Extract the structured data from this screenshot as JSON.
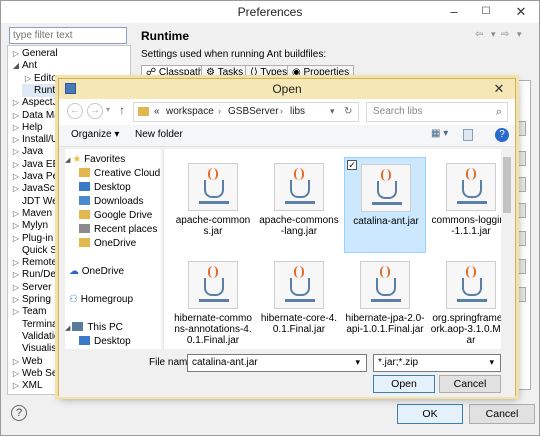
{
  "preferences": {
    "title": "Preferences",
    "minimize_icon": "–",
    "maximize_icon": "☐",
    "close_icon": "✕",
    "filter_placeholder": "type filter text",
    "tree": [
      {
        "label": "General",
        "arrow": "▷"
      },
      {
        "label": "Ant",
        "arrow": "◢"
      },
      {
        "label": "Editor",
        "arrow": "▷"
      },
      {
        "label": "Runt",
        "arrow": ""
      },
      {
        "label": "AspectJ",
        "arrow": "▷"
      },
      {
        "label": "Data Ma",
        "arrow": "▷"
      },
      {
        "label": "Help",
        "arrow": "▷"
      },
      {
        "label": "Install/U",
        "arrow": "▷"
      },
      {
        "label": "Java",
        "arrow": "▷"
      },
      {
        "label": "Java EE",
        "arrow": "▷"
      },
      {
        "label": "Java Per",
        "arrow": "▷"
      },
      {
        "label": "JavaScri",
        "arrow": "▷"
      },
      {
        "label": "JDT Wea",
        "arrow": ""
      },
      {
        "label": "Maven",
        "arrow": "▷"
      },
      {
        "label": "Mylyn",
        "arrow": "▷"
      },
      {
        "label": "Plug-in",
        "arrow": "▷"
      },
      {
        "label": "Quick Se",
        "arrow": ""
      },
      {
        "label": "Remote",
        "arrow": "▷"
      },
      {
        "label": "Run/Del",
        "arrow": "▷"
      },
      {
        "label": "Server",
        "arrow": "▷"
      },
      {
        "label": "Spring",
        "arrow": "▷"
      },
      {
        "label": "Team",
        "arrow": "▷"
      },
      {
        "label": "Termina",
        "arrow": ""
      },
      {
        "label": "Validatic",
        "arrow": ""
      },
      {
        "label": "Visualise",
        "arrow": ""
      },
      {
        "label": "Web",
        "arrow": "▷"
      },
      {
        "label": "Web Ser",
        "arrow": "▷"
      },
      {
        "label": "XML",
        "arrow": "▷"
      }
    ],
    "runtime_title": "Runtime",
    "runtime_desc": "Settings used when running Ant buildfiles:",
    "tabs": [
      "Classpath",
      "Tasks",
      "Types",
      "Properties"
    ],
    "nav_icons": {
      "back": "⇦",
      "forward": "⇨",
      "menu": "▾"
    },
    "help_icon": "?",
    "ok_label": "OK",
    "cancel_label": "Cancel"
  },
  "open_dialog": {
    "title": "Open",
    "close_icon": "✕",
    "back_icon": "←",
    "forward_icon": "→",
    "up_icon": "↑",
    "breadcrumb": [
      "«",
      "workspace",
      "GSBServer",
      "libs"
    ],
    "search_placeholder": "Search libs",
    "search_icon": "⌕",
    "organize_label": "Organize ▾",
    "new_folder_label": "New folder",
    "view_icon": "▦ ▾",
    "help_icon": "?",
    "nav_pane": [
      {
        "label": "Favorites",
        "icon_color": "#f0c040"
      },
      {
        "label": "Creative Cloud Fi",
        "icon_color": "#e2b84e"
      },
      {
        "label": "Desktop",
        "icon_color": "#3a78c8"
      },
      {
        "label": "Downloads",
        "icon_color": "#4a8ad0"
      },
      {
        "label": "Google Drive",
        "icon_color": "#e2b84e"
      },
      {
        "label": "Recent places",
        "icon_color": "#8a8a8a"
      },
      {
        "label": "OneDrive",
        "icon_color": "#e2b84e"
      },
      {
        "label": "OneDrive",
        "icon_color": "#2a6ac8"
      },
      {
        "label": "Homegroup",
        "icon_color": "#3a8ad0"
      },
      {
        "label": "This PC",
        "icon_color": "#5a7a9a"
      },
      {
        "label": "Desktop",
        "icon_color": "#3a78c8"
      }
    ],
    "files": [
      {
        "name": "apache-commons.jar",
        "selected": false
      },
      {
        "name": "apache-commons-lang.jar",
        "selected": false
      },
      {
        "name": "catalina-ant.jar",
        "selected": true
      },
      {
        "name": "commons-logging-1.1.1.jar",
        "selected": false
      },
      {
        "name": "hibernate-commons-annotations-4.0.1.Final.jar",
        "selected": false
      },
      {
        "name": "hibernate-core-4.0.1.Final.jar",
        "selected": false
      },
      {
        "name": "hibernate-jpa-2.0-api-1.0.1.Final.jar",
        "selected": false
      },
      {
        "name": "org.springframework.aop-3.1.0.M2.jar",
        "selected": false
      }
    ],
    "file_name_label": "File name:",
    "file_name_value": "catalina-ant.jar",
    "filter_value": "*.jar;*.zip",
    "dropdown_icon": "▾",
    "open_label": "Open",
    "cancel_label": "Cancel"
  }
}
